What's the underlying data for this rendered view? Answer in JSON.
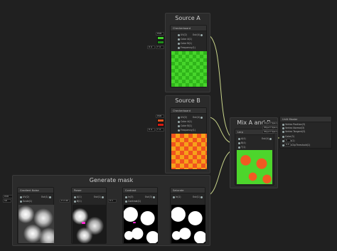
{
  "groups": {
    "source_a": "Source A",
    "source_b": "Source B",
    "mix": "Mix A and B",
    "generate_mask": "Generate mask"
  },
  "nodes": {
    "checkerboard_a": {
      "title": "Checkerboard",
      "in_uv": "UV(2)",
      "in_color_a": "Color A(1)",
      "in_color_b": "Color B(1)",
      "in_frequency": "Frequency(1)",
      "out": "Out(4)",
      "uv_field": "UV0",
      "freq_x_label": "X",
      "freq_x_value": "4",
      "freq_y_label": "Y",
      "freq_y_value": "4",
      "color_a": "#3fd12b",
      "color_b": "#1f8f1a"
    },
    "checkerboard_b": {
      "title": "Checkerboard",
      "in_uv": "UV(2)",
      "in_color_a": "Color A(1)",
      "in_color_b": "Color B(1)",
      "in_frequency": "Frequency(1)",
      "out": "Out(4)",
      "uv_field": "UV0",
      "freq_x_label": "X",
      "freq_x_value": "4",
      "freq_y_label": "Y",
      "freq_y_value": "4",
      "color_a": "#e0541d",
      "color_b": "#d41a12"
    },
    "lerp": {
      "title": "Lerp",
      "in_a": "A(4)",
      "in_b": "B(4)",
      "in_t": "T(1)",
      "out": "Out(4)"
    },
    "unlit_master": {
      "title": "Unlit Master",
      "in_position": "Vertex Position(3)",
      "in_normal": "Vertex Normal(3)",
      "in_tangent": "Vertex Tangent(3)",
      "in_color": "Color(3)",
      "in_alpha": "Alpha(1)",
      "in_alpha_clip": "AlphaClipThreshold(1)",
      "obj_space_1": "Object Space",
      "obj_space_2": "Object Space",
      "obj_space_3": "Object Space",
      "val_1": "1",
      "val_2": "0.5"
    },
    "gradient_noise": {
      "title": "Gradient Noise",
      "in_uv": "UV(2)",
      "in_scale": "Scale(1)",
      "out": "Out(1)",
      "uv_field": "UV0",
      "scale_value": "10"
    },
    "power": {
      "title": "Power",
      "in_a": "A(1)",
      "in_b": "B(1)",
      "out": "Out(1)",
      "b_x_label": "X",
      "b_x_value": "2.44"
    },
    "contrast": {
      "title": "Contrast",
      "in_in": "In(3)",
      "in_contrast": "Contrast(1)",
      "out": "Out(3)",
      "contrast_x_label": "X",
      "contrast_x_value": "1"
    },
    "saturate": {
      "title": "Saturate",
      "in_in": "In(1)",
      "out": "Out(1)"
    }
  }
}
